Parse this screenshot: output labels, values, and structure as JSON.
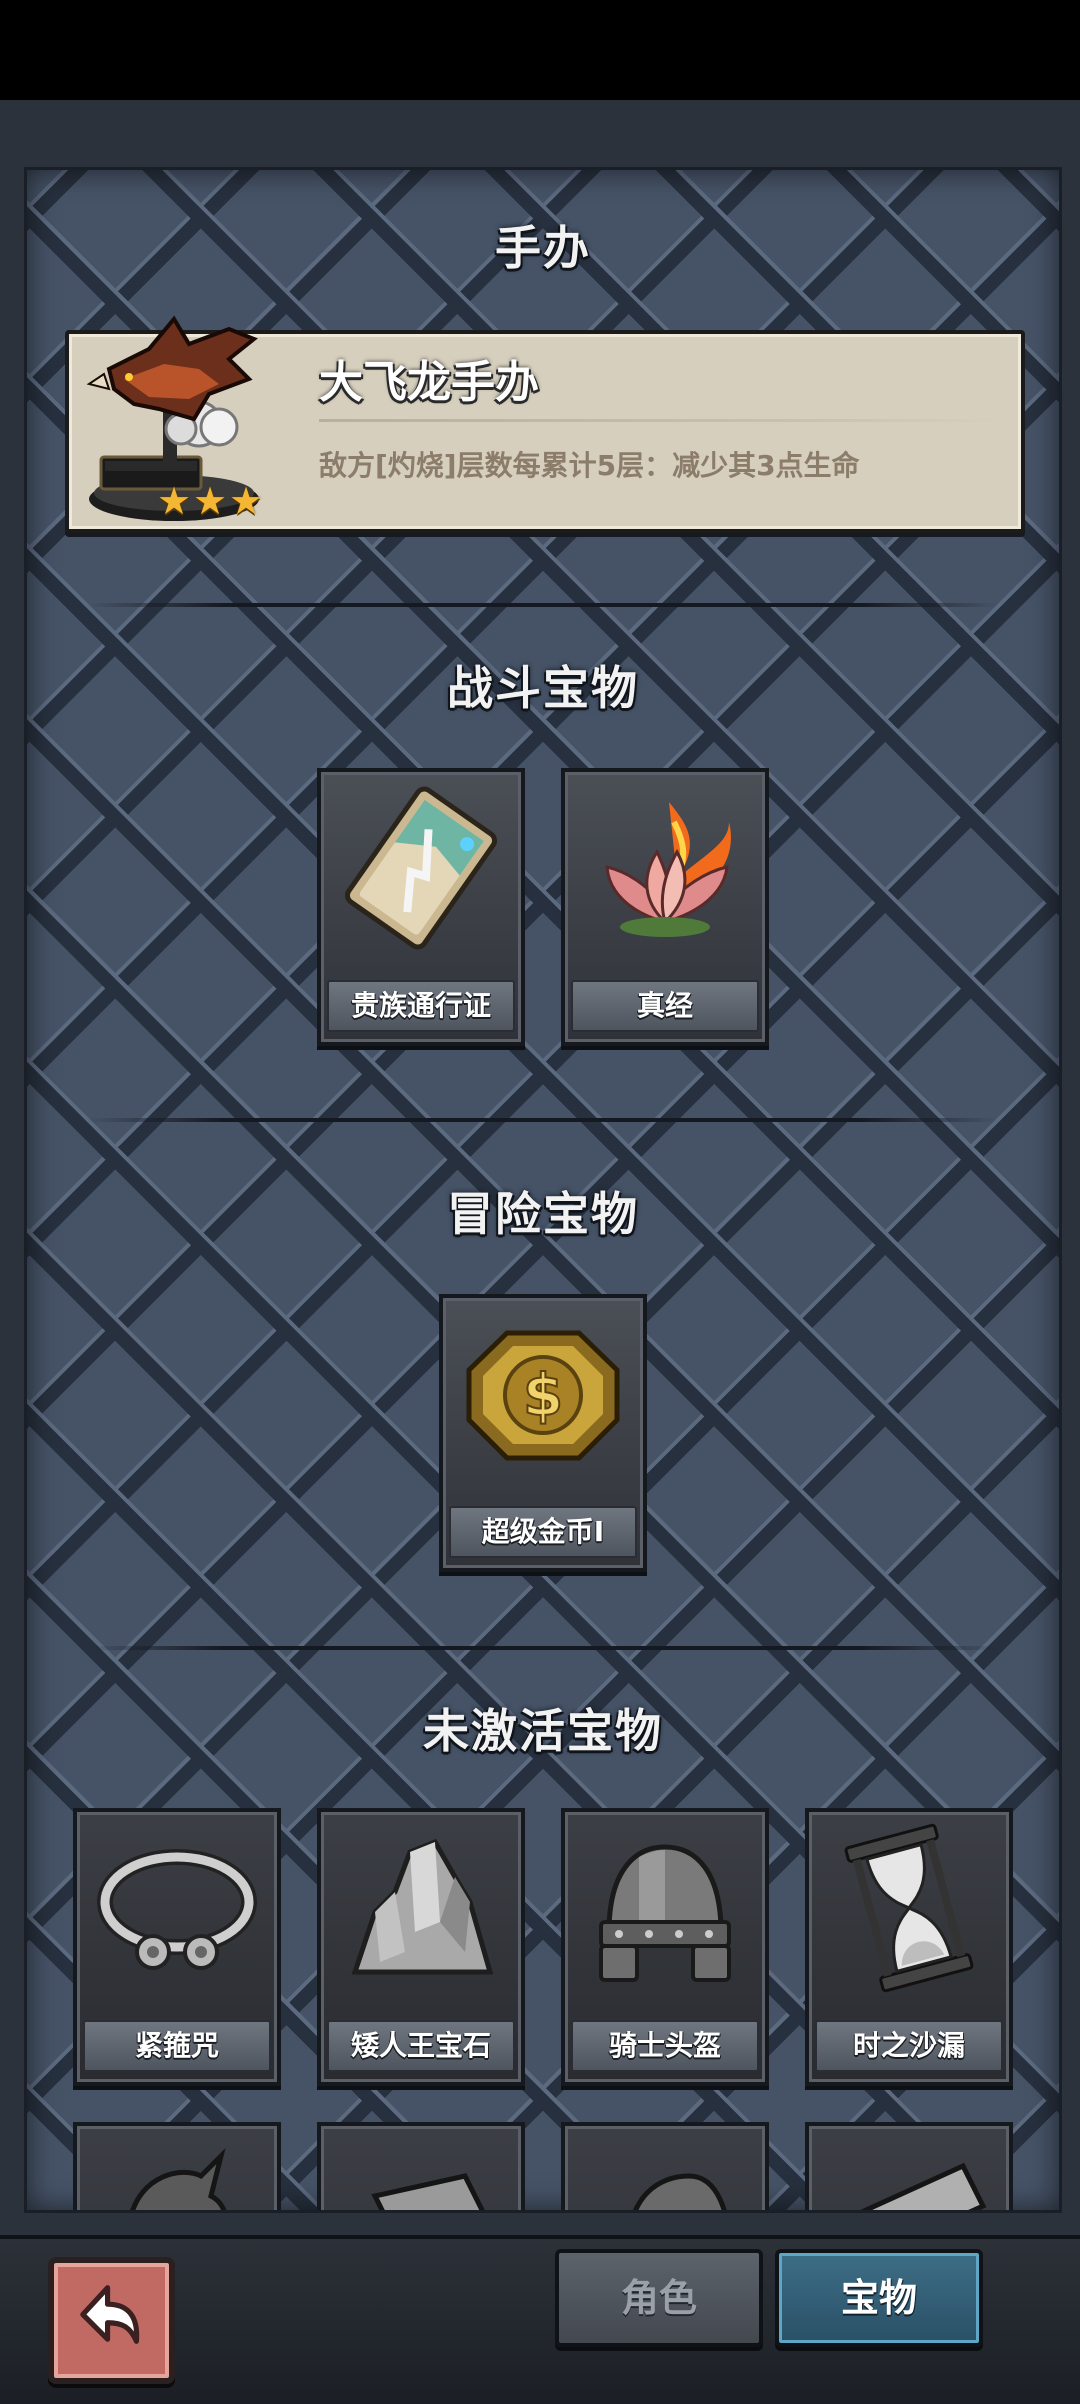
{
  "figurine_section": {
    "title": "手办",
    "item": {
      "name": "大飞龙手办",
      "description": "敌方[灼烧]层数每累计5层：减少其3点生命",
      "stars": 3
    }
  },
  "battle_section": {
    "title": "战斗宝物",
    "items": [
      {
        "name": "贵族通行证",
        "icon": "noble-pass-card-icon"
      },
      {
        "name": "真经",
        "icon": "fire-lotus-icon"
      }
    ]
  },
  "adventure_section": {
    "title": "冒险宝物",
    "items": [
      {
        "name": "超级金币I",
        "icon": "gold-coin-icon"
      }
    ]
  },
  "inactive_section": {
    "title": "未激活宝物",
    "items": [
      {
        "name": "紧箍咒",
        "icon": "golden-headband-icon"
      },
      {
        "name": "矮人王宝石",
        "icon": "dwarf-gem-icon"
      },
      {
        "name": "骑士头盔",
        "icon": "knight-helmet-icon"
      },
      {
        "name": "时之沙漏",
        "icon": "hourglass-icon"
      }
    ]
  },
  "bottom_bar": {
    "back_icon": "back-arrow-icon",
    "tabs": [
      {
        "label": "角色",
        "active": false
      },
      {
        "label": "宝物",
        "active": true
      }
    ]
  },
  "colors": {
    "panel_bg": "#465367",
    "card_bg": "#d6cfbd",
    "star": "#f4b733",
    "active_tab": "#3d6e87"
  }
}
